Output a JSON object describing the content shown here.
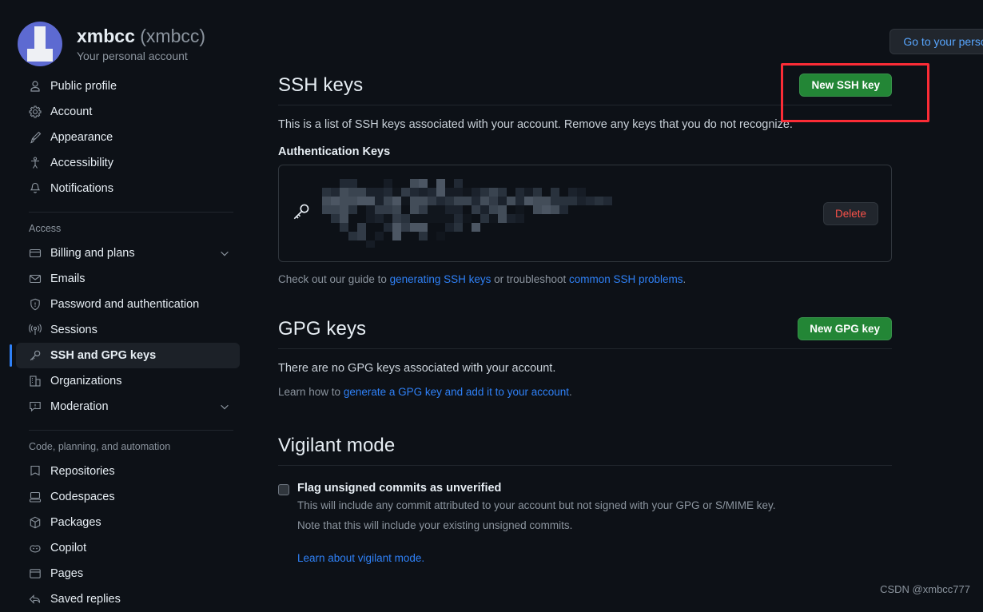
{
  "header": {
    "username": "xmbcc",
    "handle": "(xmbcc)",
    "subtitle": "Your personal account",
    "avatar_icon": "user-avatar",
    "personal_button": "Go to your personal p"
  },
  "sidebar": {
    "groups": [
      {
        "title": "",
        "items": [
          {
            "label": "Public profile",
            "icon": "person-icon",
            "selected": false,
            "chevron": false
          },
          {
            "label": "Account",
            "icon": "gear-icon",
            "selected": false,
            "chevron": false
          },
          {
            "label": "Appearance",
            "icon": "paintbrush-icon",
            "selected": false,
            "chevron": false
          },
          {
            "label": "Accessibility",
            "icon": "accessibility-icon",
            "selected": false,
            "chevron": false
          },
          {
            "label": "Notifications",
            "icon": "bell-icon",
            "selected": false,
            "chevron": false
          }
        ]
      },
      {
        "title": "Access",
        "items": [
          {
            "label": "Billing and plans",
            "icon": "credit-card-icon",
            "selected": false,
            "chevron": true
          },
          {
            "label": "Emails",
            "icon": "mail-icon",
            "selected": false,
            "chevron": false
          },
          {
            "label": "Password and authentication",
            "icon": "shield-icon",
            "selected": false,
            "chevron": false
          },
          {
            "label": "Sessions",
            "icon": "broadcast-icon",
            "selected": false,
            "chevron": false
          },
          {
            "label": "SSH and GPG keys",
            "icon": "key-icon",
            "selected": true,
            "chevron": false
          },
          {
            "label": "Organizations",
            "icon": "organization-icon",
            "selected": false,
            "chevron": false
          },
          {
            "label": "Moderation",
            "icon": "report-icon",
            "selected": false,
            "chevron": true
          }
        ]
      },
      {
        "title": "Code, planning, and automation",
        "items": [
          {
            "label": "Repositories",
            "icon": "repo-icon",
            "selected": false,
            "chevron": false
          },
          {
            "label": "Codespaces",
            "icon": "codespaces-icon",
            "selected": false,
            "chevron": false
          },
          {
            "label": "Packages",
            "icon": "package-icon",
            "selected": false,
            "chevron": false
          },
          {
            "label": "Copilot",
            "icon": "copilot-icon",
            "selected": false,
            "chevron": false
          },
          {
            "label": "Pages",
            "icon": "browser-icon",
            "selected": false,
            "chevron": false
          },
          {
            "label": "Saved replies",
            "icon": "reply-icon",
            "selected": false,
            "chevron": false
          }
        ]
      }
    ]
  },
  "ssh_section": {
    "title": "SSH keys",
    "new_key_button": "New SSH key",
    "description": "This is a list of SSH keys associated with your account. Remove any keys that you do not recognize.",
    "auth_keys_label": "Authentication Keys",
    "key_entry": {
      "icon": "key-icon",
      "redacted": true,
      "delete_button": "Delete"
    },
    "guide_prefix": "Check out our guide to ",
    "guide_link_1": "generating SSH keys",
    "guide_middle": " or troubleshoot ",
    "guide_link_2": "common SSH problems",
    "guide_suffix": "."
  },
  "gpg_section": {
    "title": "GPG keys",
    "new_key_button": "New GPG key",
    "empty_text": "There are no GPG keys associated with your account.",
    "learn_prefix": "Learn how to ",
    "learn_link": "generate a GPG key and add it to your account",
    "learn_suffix": "."
  },
  "vigilant_section": {
    "title": "Vigilant mode",
    "checkbox_label": "Flag unsigned commits as unverified",
    "checkbox_checked": false,
    "desc_line_1": "This will include any commit attributed to your account but not signed with your GPG or S/MIME key.",
    "desc_line_2": "Note that this will include your existing unsigned commits.",
    "learn_link": "Learn about vigilant mode."
  },
  "annotation": {
    "color": "#fb2c36",
    "target": "new-ssh-key-button"
  },
  "watermark": "CSDN @xmbcc777",
  "colors": {
    "background": "#0d1117",
    "accent_green": "#238636",
    "link_blue": "#2f81f7",
    "danger_red": "#f85149",
    "selected_bar": "#2f81f7",
    "annotation_red": "#fb2c36"
  }
}
